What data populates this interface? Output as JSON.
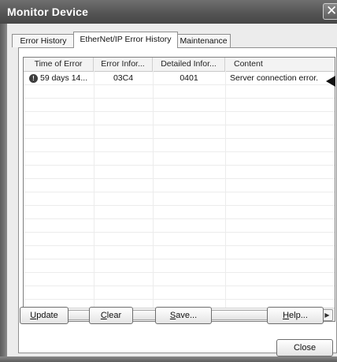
{
  "window": {
    "title": "Monitor Device",
    "close_glyph": "✕"
  },
  "tabs": [
    {
      "label": "Error History"
    },
    {
      "label": "EtherNet/IP Error History"
    },
    {
      "label": "Maintenance"
    }
  ],
  "table": {
    "columns": [
      "Time of Error",
      "Error Infor...",
      "Detailed Infor...",
      "Content"
    ],
    "rows": [
      {
        "icon": "error-icon",
        "icon_glyph": "!",
        "time": "59 days 14...",
        "error_info": "03C4",
        "detail_info": "0401",
        "content": "Server connection error."
      }
    ]
  },
  "scrollbar": {
    "left_glyph": "◀",
    "right_glyph": "▶"
  },
  "buttons": {
    "update": {
      "key": "U",
      "rest": "pdate"
    },
    "clear": {
      "key": "C",
      "rest": "lear"
    },
    "save": {
      "key": "S",
      "rest": "ave..."
    },
    "help": {
      "key": "H",
      "rest": "elp..."
    },
    "close": "Close"
  }
}
